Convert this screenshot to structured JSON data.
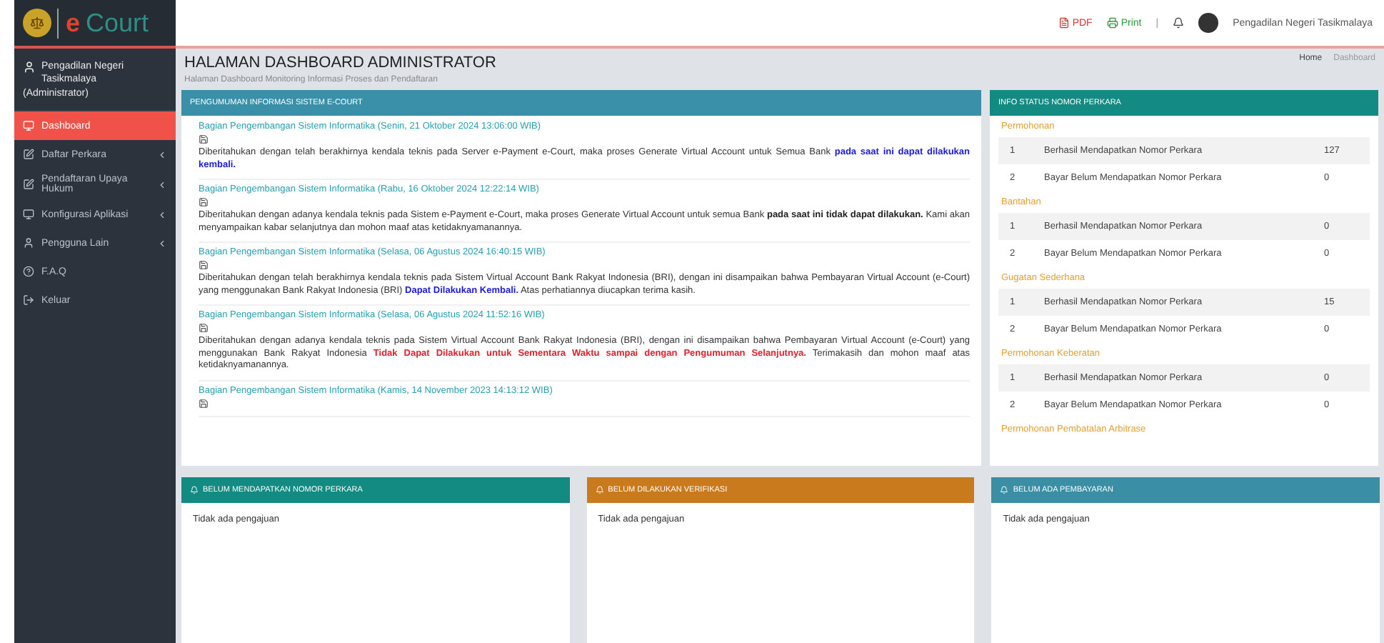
{
  "logo": {
    "letter": "e",
    "word": "Court"
  },
  "user": {
    "name": "Pengadilan Negeri Tasikmalaya",
    "role": "(Administrator)"
  },
  "sidebar": {
    "items": [
      {
        "label": "Dashboard",
        "kind": "monitor",
        "selected": true,
        "expandable": false
      },
      {
        "label": "Daftar Perkara",
        "kind": "edit",
        "selected": false,
        "expandable": true
      },
      {
        "label": "Pendaftaran Upaya Hukum",
        "kind": "edit",
        "selected": false,
        "expandable": true
      },
      {
        "label": "Konfigurasi Aplikasi",
        "kind": "monitor",
        "selected": false,
        "expandable": true
      },
      {
        "label": "Pengguna Lain",
        "kind": "user",
        "selected": false,
        "expandable": true
      },
      {
        "label": "F.A.Q",
        "kind": "help",
        "selected": false,
        "expandable": false
      },
      {
        "label": "Keluar",
        "kind": "logout",
        "selected": false,
        "expandable": false
      }
    ]
  },
  "topbar": {
    "pdf": "PDF",
    "print": "Print",
    "separator": "|",
    "user_name": "Pengadilan Negeri Tasikmalaya"
  },
  "page": {
    "title": "HALAMAN DASHBOARD ADMINISTRATOR",
    "subtitle": "Halaman Dashboard Monitoring Informasi Proses dan Pendaftaran",
    "breadcrumb": [
      "Home",
      "Dashboard"
    ]
  },
  "announcements": {
    "title": "PENGUMUMAN INFORMASI SISTEM E-COURT",
    "items": [
      {
        "heading": "Bagian Pengembangan Sistem Informatika (Senin, 21 Oktober 2024 13:06:00 WIB)",
        "parts": [
          {
            "kind": "plain",
            "text": "Diberitahukan dengan telah berakhirnya kendala teknis pada Server e-Payment e-Court, maka proses Generate Virtual Account untuk Semua Bank "
          },
          {
            "kind": "link",
            "text": "pada saat ini dapat dilakukan kembali."
          }
        ]
      },
      {
        "heading": "Bagian Pengembangan Sistem Informatika (Rabu, 16 Oktober 2024 12:22:14 WIB)",
        "parts": [
          {
            "kind": "plain",
            "text": "Diberitahukan dengan adanya kendala teknis pada Sistem e-Payment e-Court, maka proses Generate Virtual Account untuk semua Bank "
          },
          {
            "kind": "bold",
            "text": "pada saat ini tidak dapat dilakukan."
          },
          {
            "kind": "plain",
            "text": " Kami akan menyampaikan kabar selanjutnya dan mohon maaf atas ketidaknyamanannya."
          }
        ]
      },
      {
        "heading": "Bagian Pengembangan Sistem Informatika (Selasa, 06 Agustus 2024 16:40:15 WIB)",
        "parts": [
          {
            "kind": "plain",
            "text": "Diberitahukan dengan telah berakhirnya kendala teknis pada Sistem Virtual Account Bank Rakyat Indonesia (BRI), dengan ini disampaikan bahwa Pembayaran Virtual Account (e-Court) yang menggunakan Bank Rakyat Indonesia (BRI) "
          },
          {
            "kind": "link",
            "text": "Dapat Dilakukan Kembali."
          },
          {
            "kind": "plain",
            "text": " Atas perhatiannya diucapkan terima kasih."
          }
        ]
      },
      {
        "heading": "Bagian Pengembangan Sistem Informatika (Selasa, 06 Agustus 2024 11:52:16 WIB)",
        "parts": [
          {
            "kind": "plain",
            "text": "Diberitahukan dengan adanya kendala teknis pada Sistem Virtual Account Bank Rakyat Indonesia (BRI), dengan ini disampaikan bahwa Pembayaran Virtual Account (e-Court) yang menggunakan Bank Rakyat Indonesia "
          },
          {
            "kind": "alert",
            "text": "Tidak Dapat Dilakukan untuk Sementara Waktu sampai dengan Pengumuman Selanjutnya."
          },
          {
            "kind": "plain",
            "text": " Terimakasih dan mohon maaf atas ketidaknyamanannya."
          }
        ]
      },
      {
        "heading": "Bagian Pengembangan Sistem Informatika (Kamis, 14 November 2023 14:13:12 WIB)"
      }
    ]
  },
  "status": {
    "title": "INFO STATUS NOMOR PERKARA",
    "groups": [
      {
        "name": "Permohonan",
        "rows": [
          {
            "no": "1",
            "label": "Berhasil Mendapatkan Nomor Perkara",
            "count": "127"
          },
          {
            "no": "2",
            "label": "Bayar Belum Mendapatkan Nomor Perkara",
            "count": "0"
          }
        ]
      },
      {
        "name": "Bantahan",
        "rows": [
          {
            "no": "1",
            "label": "Berhasil Mendapatkan Nomor Perkara",
            "count": "0"
          },
          {
            "no": "2",
            "label": "Bayar Belum Mendapatkan Nomor Perkara",
            "count": "0"
          }
        ]
      },
      {
        "name": "Gugatan Sederhana",
        "rows": [
          {
            "no": "1",
            "label": "Berhasil Mendapatkan Nomor Perkara",
            "count": "15"
          },
          {
            "no": "2",
            "label": "Bayar Belum Mendapatkan Nomor Perkara",
            "count": "0"
          }
        ]
      },
      {
        "name": "Permohonan Keberatan",
        "rows": [
          {
            "no": "1",
            "label": "Berhasil Mendapatkan Nomor Perkara",
            "count": "0"
          },
          {
            "no": "2",
            "label": "Bayar Belum Mendapatkan Nomor Perkara",
            "count": "0"
          }
        ]
      },
      {
        "name": "Permohonan Pembatalan Arbitrase"
      }
    ]
  },
  "bottom_panels": [
    {
      "title": "BELUM MENDAPATKAN NOMOR PERKARA",
      "color": "#138a82",
      "body": "Tidak ada pengajuan"
    },
    {
      "title": "BELUM DILAKUKAN VERIFIKASI",
      "color": "#c87a1c",
      "body": "Tidak ada pengajuan"
    },
    {
      "title": "BELUM ADA PEMBAYARAN",
      "color": "#3a8fa5",
      "body": "Tidak ada pengajuan"
    }
  ]
}
